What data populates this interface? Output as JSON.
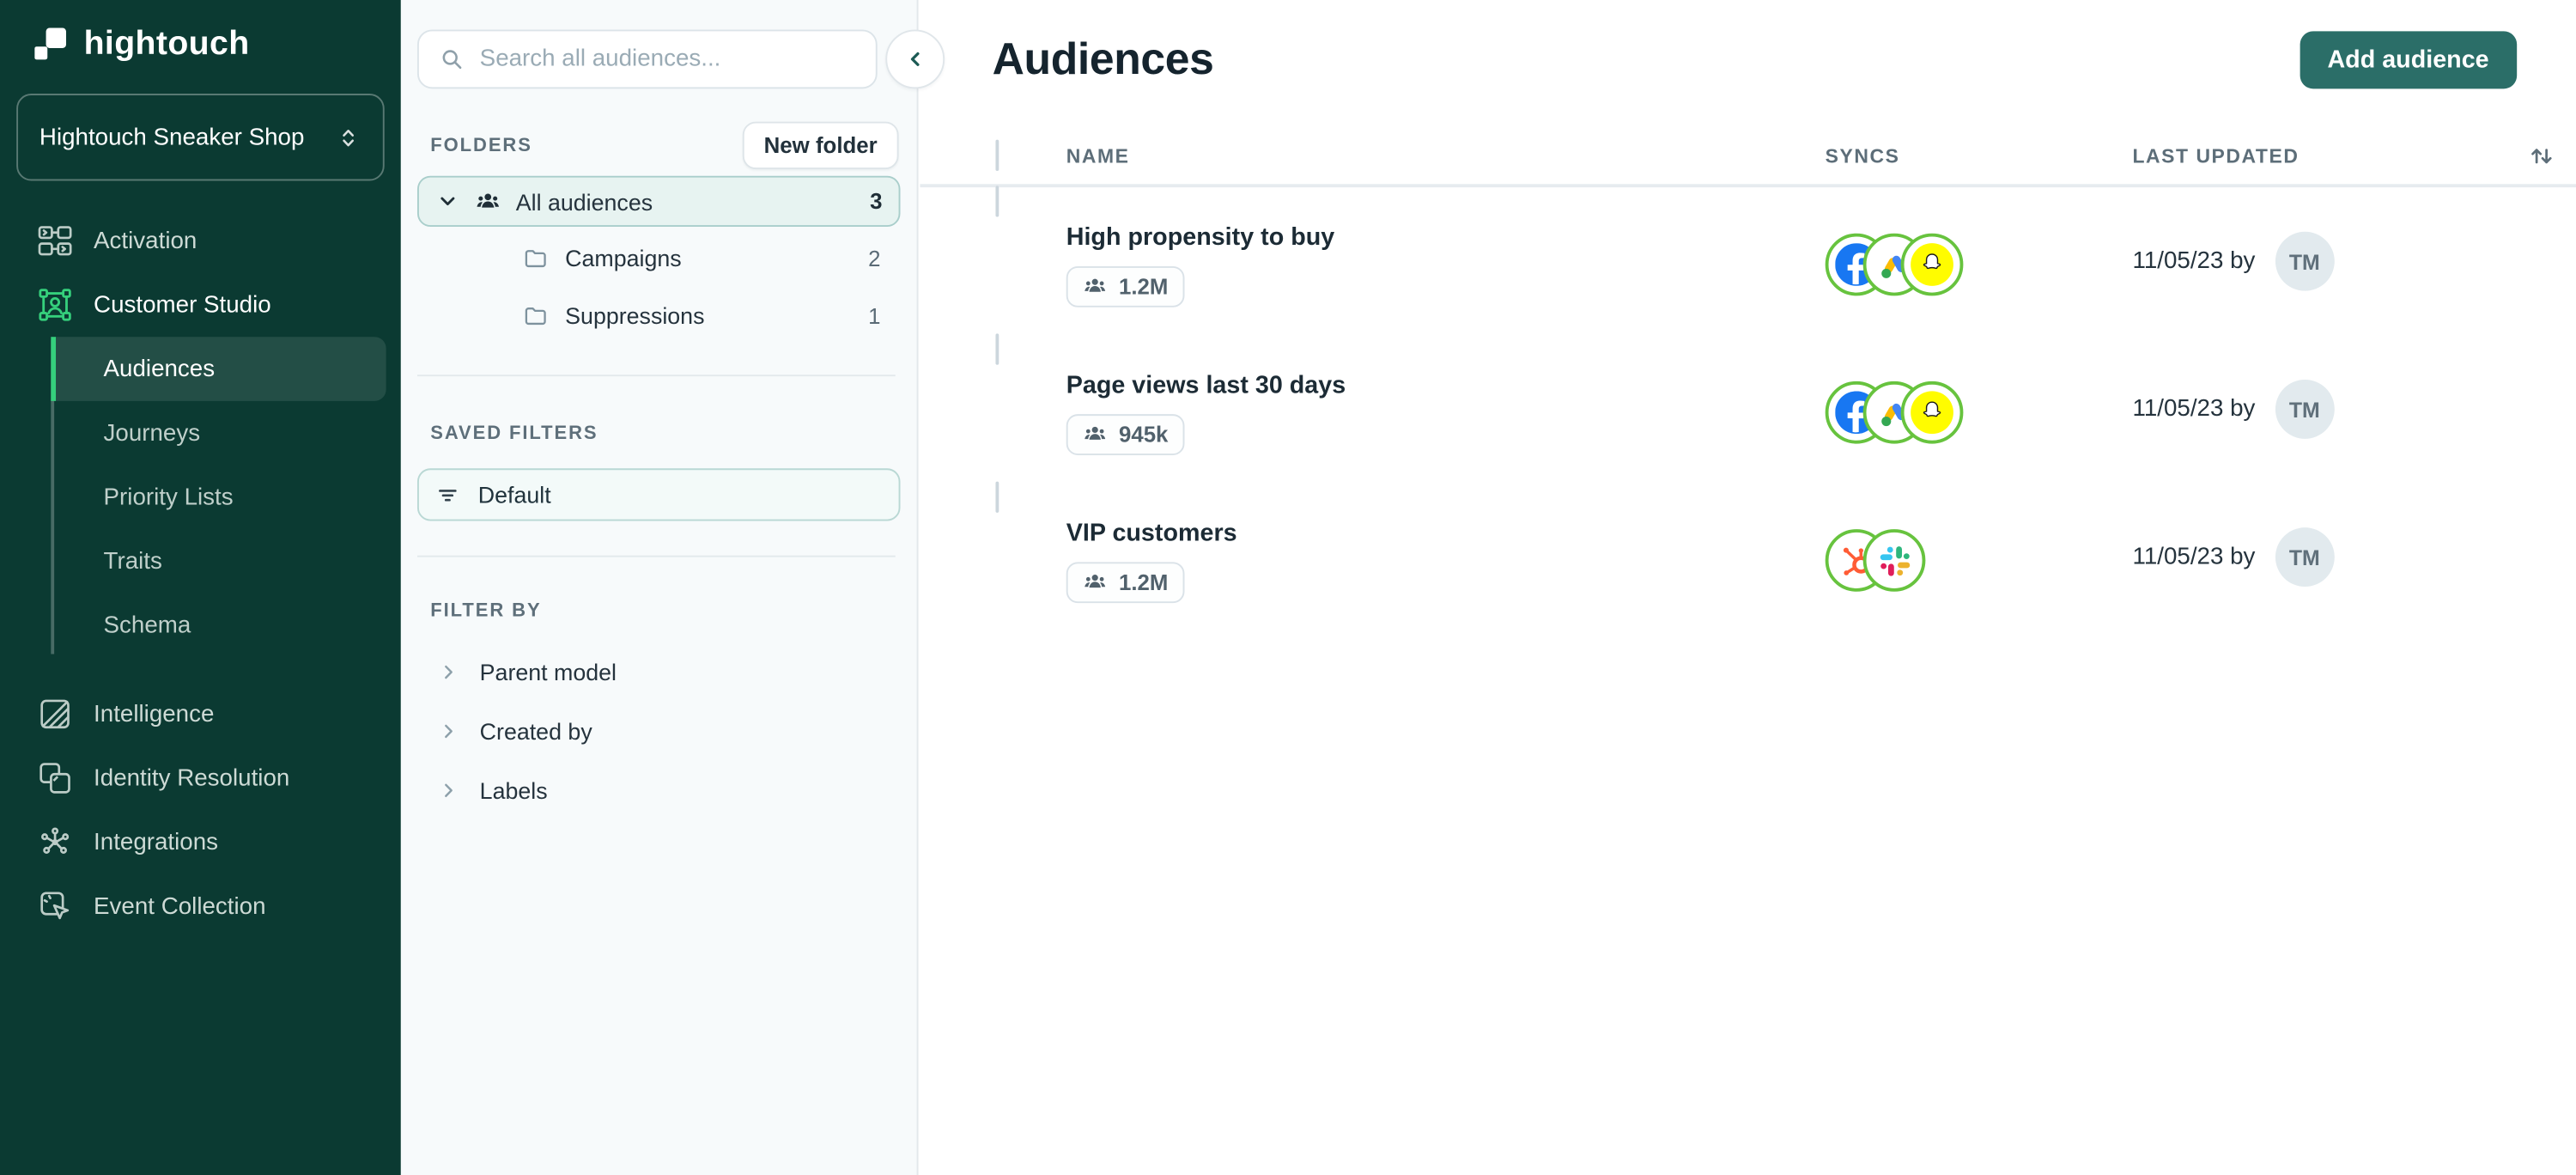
{
  "app": {
    "logo_text": "hightouch"
  },
  "colors": {
    "sidebar_bg": "#0B3A32",
    "accent_green": "#35D07C",
    "ring_green": "#67C33E",
    "button_teal": "#2B6E68",
    "selected_bg": "#E7F3F1",
    "selected_border": "#A9CECB",
    "avatar_bg": "#E2EAEE"
  },
  "sidebar": {
    "workspace_name": "Hightouch Sneaker Shop",
    "nav": [
      {
        "label": "Activation",
        "icon": "activation-icon"
      },
      {
        "label": "Customer Studio",
        "icon": "customer-studio-icon",
        "active": true
      }
    ],
    "customer_studio_subnav": [
      {
        "label": "Audiences",
        "selected": true
      },
      {
        "label": "Journeys"
      },
      {
        "label": "Priority Lists"
      },
      {
        "label": "Traits"
      },
      {
        "label": "Schema"
      }
    ],
    "nav_secondary": [
      {
        "label": "Intelligence",
        "icon": "intelligence-icon"
      },
      {
        "label": "Identity Resolution",
        "icon": "identity-resolution-icon"
      },
      {
        "label": "Integrations",
        "icon": "integrations-icon"
      },
      {
        "label": "Event Collection",
        "icon": "event-collection-icon"
      }
    ]
  },
  "panel": {
    "search_placeholder": "Search all audiences...",
    "folders_label": "FOLDERS",
    "new_folder_button": "New folder",
    "folders": [
      {
        "name": "All audiences",
        "count": "3",
        "selected": true,
        "icon": "people-icon"
      },
      {
        "name": "Campaigns",
        "count": "2",
        "icon": "folder-icon"
      },
      {
        "name": "Suppressions",
        "count": "1",
        "icon": "folder-icon"
      }
    ],
    "saved_filters_label": "SAVED FILTERS",
    "saved_filters": [
      {
        "name": "Default",
        "icon": "filter-icon"
      }
    ],
    "filter_by_label": "FILTER BY",
    "filter_by": [
      {
        "label": "Parent model"
      },
      {
        "label": "Created by"
      },
      {
        "label": "Labels"
      }
    ]
  },
  "main": {
    "title": "Audiences",
    "add_audience_button": "Add audience",
    "table": {
      "columns": {
        "name": "NAME",
        "syncs": "SYNCS",
        "last_updated": "LAST UPDATED"
      },
      "rows": [
        {
          "name": "High propensity to buy",
          "size": "1.2M",
          "syncs": [
            "facebook",
            "google-ads",
            "snapchat"
          ],
          "last_updated": "11/05/23 by",
          "avatar_initials": "TM"
        },
        {
          "name": "Page views last 30 days",
          "size": "945k",
          "syncs": [
            "facebook",
            "google-ads",
            "snapchat"
          ],
          "last_updated": "11/05/23 by",
          "avatar_initials": "TM"
        },
        {
          "name": "VIP customers",
          "size": "1.2M",
          "syncs": [
            "hubspot",
            "slack"
          ],
          "last_updated": "11/05/23 by",
          "avatar_initials": "TM"
        }
      ]
    }
  }
}
